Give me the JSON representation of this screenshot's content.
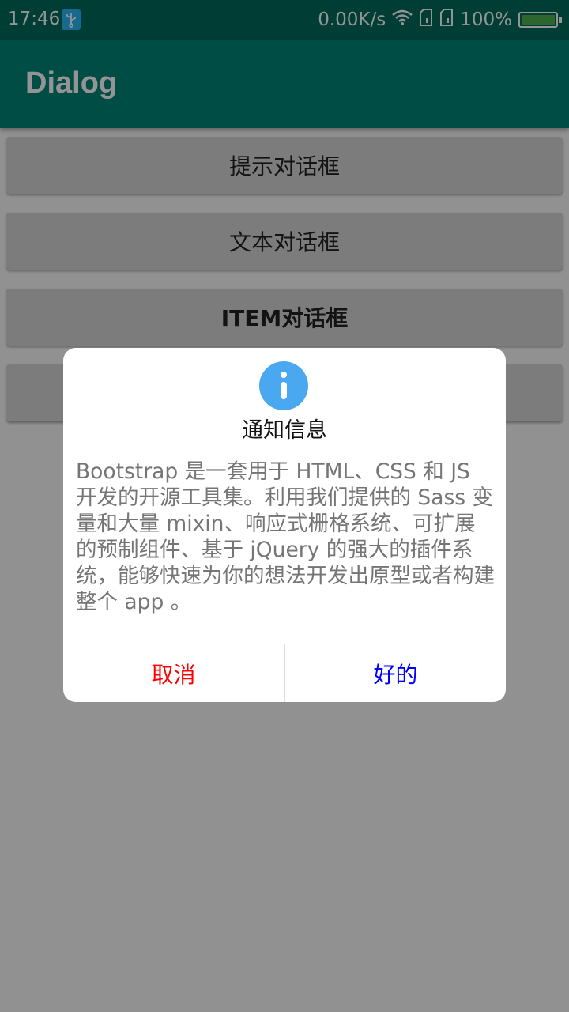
{
  "status_bar": {
    "time": "17:46",
    "net_speed": "0.00K/s",
    "battery": "100%"
  },
  "app_bar": {
    "title": "Dialog"
  },
  "buttons": [
    {
      "label": "提示对话框"
    },
    {
      "label": "文本对话框"
    },
    {
      "label": "ITEM对话框"
    },
    {
      "label": ""
    }
  ],
  "dialog": {
    "title": "通知信息",
    "message": "Bootstrap 是一套用于 HTML、CSS 和 JS 开发的开源工具集。利用我们提供的 Sass 变量和大量 mixin、响应式栅格系统、可扩展的预制组件、基于 jQuery 的强大的插件系统，能够快速为你的想法开发出原型或者构建整个 app 。",
    "cancel_label": "取消",
    "ok_label": "好的",
    "icon": "info-icon"
  },
  "colors": {
    "status_bar": "#00695c",
    "app_bar": "#008577",
    "cancel": "#ff0000",
    "ok": "#0000ff",
    "info": "#4aa8f0"
  }
}
